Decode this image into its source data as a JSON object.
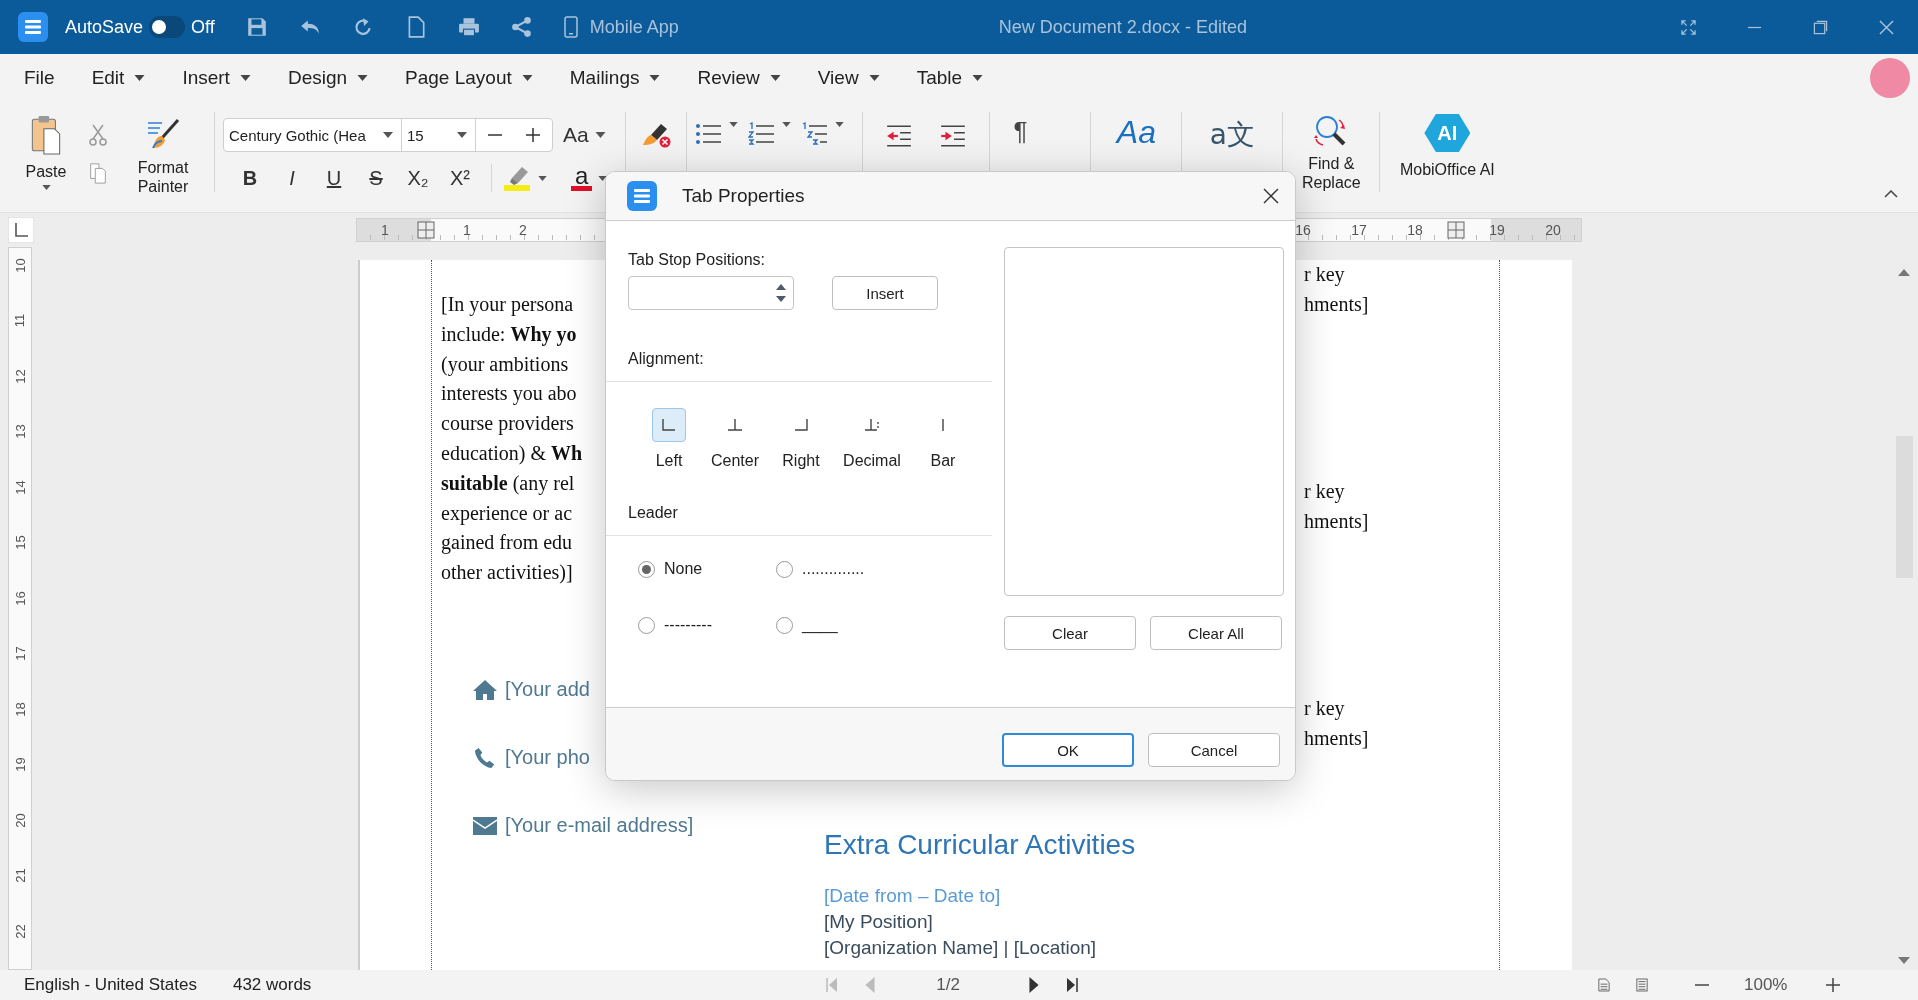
{
  "title_bar": {
    "autosave_label": "AutoSave",
    "autosave_on": false,
    "autosave_state": "Off",
    "mobile_app": "Mobile App",
    "document_title": "New Document 2.docx - Edited"
  },
  "menu": [
    {
      "label": "File",
      "dropdown": false
    },
    {
      "label": "Edit",
      "dropdown": true
    },
    {
      "label": "Insert",
      "dropdown": true
    },
    {
      "label": "Design",
      "dropdown": true
    },
    {
      "label": "Page Layout",
      "dropdown": true
    },
    {
      "label": "Mailings",
      "dropdown": true
    },
    {
      "label": "Review",
      "dropdown": true
    },
    {
      "label": "View",
      "dropdown": true
    },
    {
      "label": "Table",
      "dropdown": true
    }
  ],
  "ribbon": {
    "paste_label": "Paste",
    "format_painter_label": "Format Painter",
    "font_name": "Century Gothic (Hea",
    "font_size": "15",
    "change_case": "Aa",
    "format_buttons": [
      {
        "kind": "bold",
        "label": "B"
      },
      {
        "kind": "italic",
        "label": "I"
      },
      {
        "kind": "underline",
        "label": "U"
      },
      {
        "kind": "strike",
        "label": "S"
      },
      {
        "kind": "sub",
        "label": "X₂"
      },
      {
        "kind": "sup",
        "label": "X²"
      }
    ],
    "font_color_glyph": "a",
    "pilcrow": "¶",
    "styles_glyph": "Aa",
    "translate_glyph": "a文",
    "find_replace_label": "Find & Replace",
    "ai_badge": "AI",
    "ai_label": "MobiOffice AI"
  },
  "rulers": {
    "top_left": [
      {
        "kind": "number",
        "label": "1"
      },
      {
        "kind": "marker"
      },
      {
        "kind": "number",
        "label": "1"
      },
      {
        "kind": "number",
        "label": "2"
      }
    ],
    "top_right": [
      {
        "kind": "number",
        "label": "16"
      },
      {
        "kind": "number",
        "label": "17"
      },
      {
        "kind": "number",
        "label": "18"
      },
      {
        "kind": "marker"
      },
      {
        "kind": "number",
        "label": "19"
      },
      {
        "kind": "number",
        "label": "20"
      }
    ],
    "vertical": [
      "10",
      "11",
      "12",
      "13",
      "14",
      "15",
      "16",
      "17",
      "18",
      "19",
      "20",
      "21",
      "22"
    ]
  },
  "document": {
    "paragraph": [
      "[In your persona",
      "include: **Why yo**",
      "(your ambitions",
      "interests you abo",
      "course providers",
      "education) & **Wh**",
      "**suitable** (any rel",
      "experience or ac",
      "gained from edu",
      "other activities)]"
    ],
    "contacts": [
      {
        "kind": "home",
        "text": "[Your add"
      },
      {
        "kind": "phone",
        "text": "[Your pho"
      },
      {
        "kind": "email",
        "text": "[Your e-mail address]"
      }
    ],
    "right_fragments": [
      [
        "r key",
        "hments]"
      ],
      [
        "r key",
        "hments]"
      ],
      [
        "r key",
        "hments]"
      ]
    ],
    "section_heading": "Extra Curricular Activities",
    "date_range": "[Date from – Date to]",
    "position": "[My Position]",
    "organization": "[Organization Name] | [Location]"
  },
  "dialog": {
    "title": "Tab Properties",
    "tab_stop_label": "Tab Stop Positions:",
    "insert": "Insert",
    "alignment_label": "Alignment:",
    "alignments": [
      {
        "kind": "left",
        "label": "Left",
        "selected": true
      },
      {
        "kind": "center",
        "label": "Center",
        "selected": false
      },
      {
        "kind": "right",
        "label": "Right",
        "selected": false
      },
      {
        "kind": "decimal",
        "label": "Decimal",
        "selected": false
      },
      {
        "kind": "bar",
        "label": "Bar",
        "selected": false
      }
    ],
    "leader_label": "Leader",
    "leaders": [
      {
        "label": "None",
        "selected": true
      },
      {
        "label": "..............",
        "selected": false
      },
      {
        "label": "---------",
        "selected": false
      },
      {
        "label": "____",
        "selected": false
      }
    ],
    "clear": "Clear",
    "clear_all": "Clear All",
    "ok": "OK",
    "cancel": "Cancel"
  },
  "status_bar": {
    "language": "English - United States",
    "word_count": "432 words",
    "page": "1/2",
    "zoom": "100%"
  }
}
